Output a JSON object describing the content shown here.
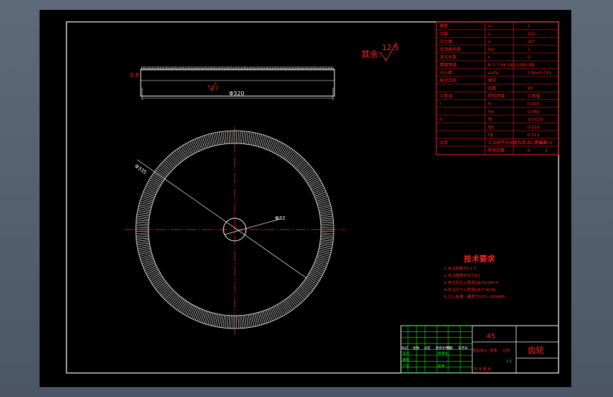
{
  "surface_finish": {
    "label": "其余:",
    "value": "12.5"
  },
  "side_view": {
    "width_dim": "Φ320",
    "chamfer": "0.8",
    "roughness": "3.2"
  },
  "front_view": {
    "outer_dim": "Φ335",
    "bore_dim": "Φ32"
  },
  "gear_table": [
    [
      "模数",
      "m",
      "1"
    ],
    [
      "齿数",
      "z₁",
      "320"
    ],
    [
      "压力角",
      "α",
      "20°"
    ],
    [
      "齿顶高系数",
      "ha*",
      "1"
    ],
    [
      "变位系数",
      "x",
      "0"
    ],
    [
      "精度等级",
      "8-7-7 HK GB10095-88",
      ""
    ],
    [
      "中心距",
      "a±fa",
      "176±0.035"
    ],
    [
      "配对齿轮",
      "图号",
      ""
    ],
    [
      "",
      "齿数",
      "90"
    ],
    [
      "公差组",
      "检验项目",
      "公差值"
    ],
    [
      "I",
      "Fr",
      "0.045"
    ],
    [
      "",
      "Fw",
      "0.060"
    ],
    [
      "II",
      "ffr",
      "±0.020"
    ],
    [
      "",
      "fpt",
      "0.019"
    ],
    [
      "",
      "Fβ",
      "0.011"
    ],
    [
      "齿厚",
      "公法线平均长度及其上、下偏差",
      "33.87±0.05"
    ],
    [
      "",
      "跨测齿数",
      "K",
      "5"
    ]
  ],
  "tech_requirements": {
    "title": "技术要求",
    "items": [
      "1.未注倒角为C1.5",
      "2.未注圆角半径为R2",
      "3.未注形位公差按GB/T1184-K",
      "4.未注尺寸公差按GB/T 4249",
      "5.正火处理，硬度为170~200HBS"
    ]
  },
  "title_block": {
    "material": "45",
    "part_name": "齿轮",
    "scale": "1:1",
    "rows_left": [
      "标记",
      "处数",
      "分区",
      "更改文件号",
      "签名",
      "年月日"
    ],
    "design": "设计",
    "check": "审核",
    "craft": "工艺",
    "standardize": "标准化",
    "approve": "批准",
    "stage_label": "阶段标记",
    "weight_label": "重量",
    "scale_label": "比例",
    "sheet_label": "共 张 第 张"
  },
  "colors": {
    "lines": "#ff2020",
    "gear": "#ffffff",
    "table": "#00ff00",
    "sheet": "#000000"
  }
}
